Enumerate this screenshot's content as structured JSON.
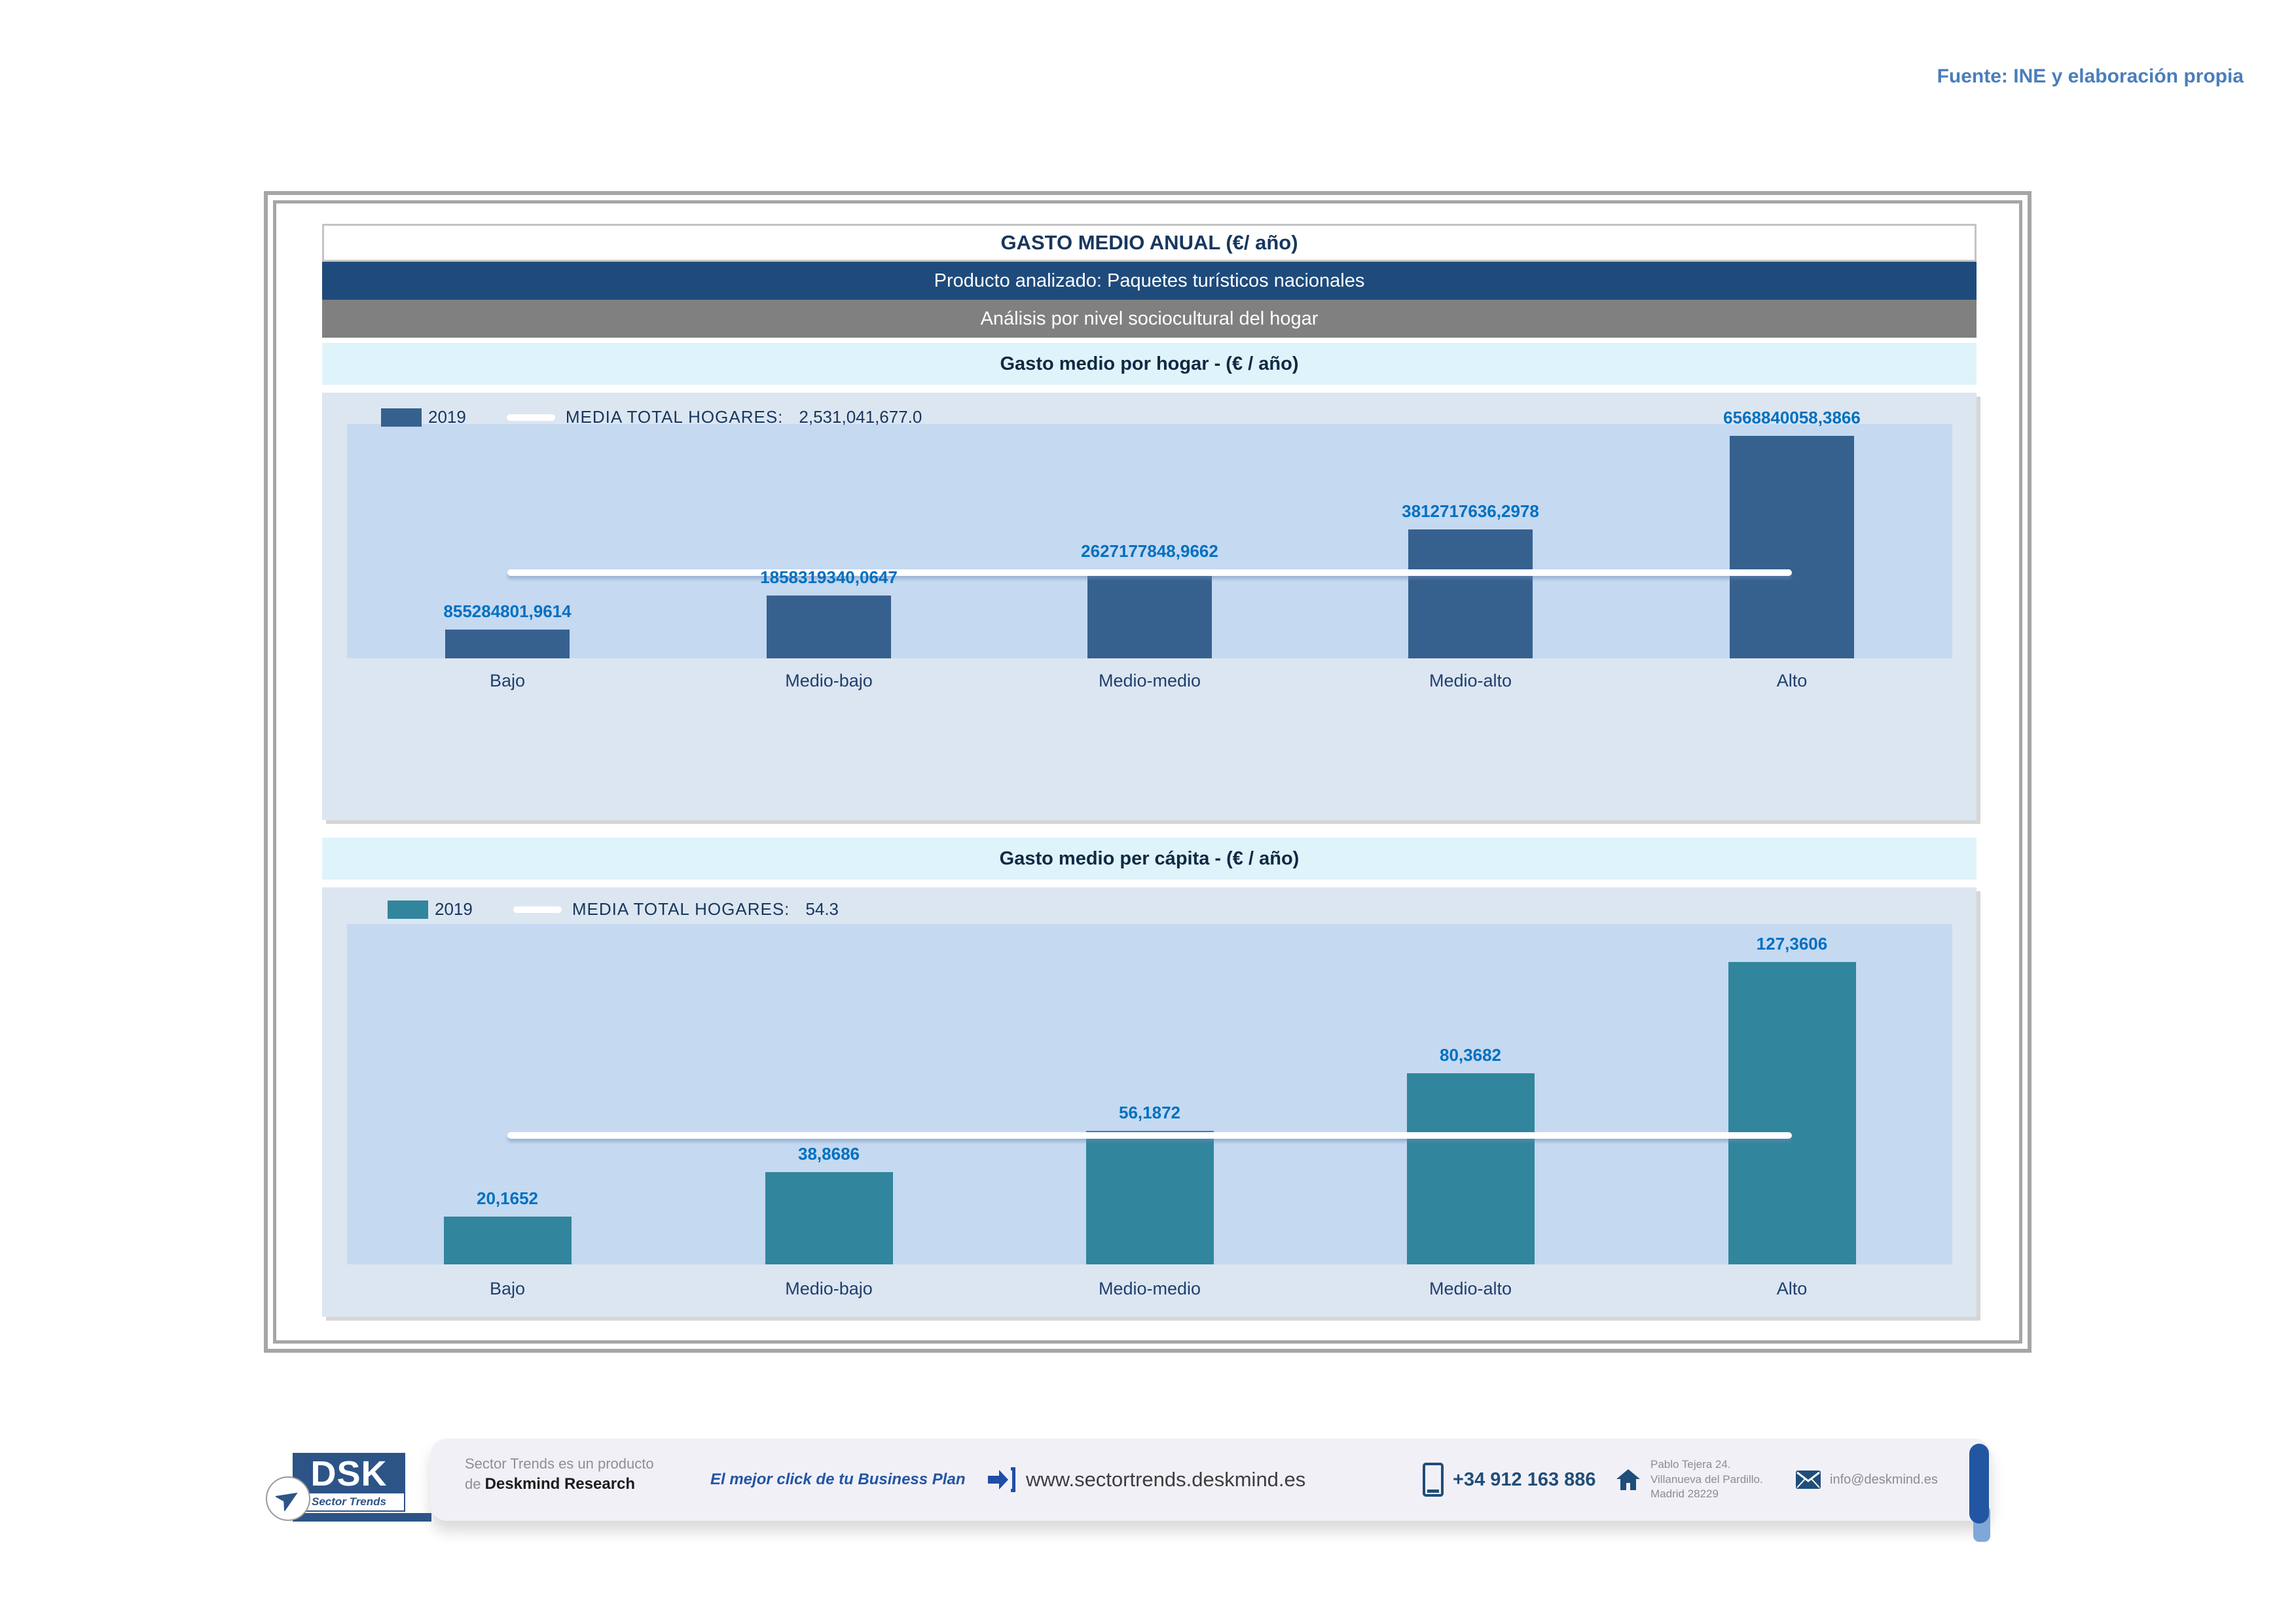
{
  "page": {
    "source_note": "Fuente: INE y elaboración propia"
  },
  "header": {
    "title": "GASTO MEDIO ANUAL (€/ año)",
    "product_bar": "Producto analizado: Paquetes turísticos nacionales",
    "analysis_bar": "Análisis por nivel sociocultural del hogar"
  },
  "chart_data": [
    {
      "type": "bar",
      "section_title": "Gasto medio por hogar -  (€ / año)",
      "legend": {
        "series_label": "2019",
        "mean_label": "MEDIA TOTAL  HOGARES:",
        "mean_value_text": "2,531,041,677.0"
      },
      "categories": [
        "Bajo",
        "Medio-bajo",
        "Medio-medio",
        "Medio-alto",
        "Alto"
      ],
      "values": [
        855284801.9614,
        1858319340.0647,
        2627177848.9662,
        3812717636.2978,
        6568840058.3866
      ],
      "value_labels": [
        "855284801,9614",
        "1858319340,0647",
        "2627177848,9662",
        "3812717636,2978",
        "6568840058,3866"
      ],
      "mean_value": 2531041677.0,
      "bar_color": "#36618E",
      "mean_line_color": "#FFFFFF",
      "plot_bg": "#C5D9F1",
      "panel_bg": "#DCE6F1",
      "value_label_color": "#0070C0",
      "legend_position": "top-left",
      "grid": false
    },
    {
      "type": "bar",
      "section_title": "Gasto medio per cápita -  (€ / año)",
      "legend": {
        "series_label": "2019",
        "mean_label": "MEDIA TOTAL  HOGARES:",
        "mean_value_text": "54.3"
      },
      "categories": [
        "Bajo",
        "Medio-bajo",
        "Medio-medio",
        "Medio-alto",
        "Alto"
      ],
      "values": [
        20.1652,
        38.8686,
        56.1872,
        80.3682,
        127.3606
      ],
      "value_labels": [
        "20,1652",
        "38,8686",
        "56,1872",
        "80,3682",
        "127,3606"
      ],
      "mean_value": 54.3,
      "bar_color": "#31859C",
      "mean_line_color": "#FFFFFF",
      "plot_bg": "#C5D9F1",
      "panel_bg": "#DCE6F1",
      "value_label_color": "#0070C0",
      "legend_position": "top-left",
      "grid": false
    }
  ],
  "footer": {
    "logo": {
      "acronym": "DSK",
      "sublabel": "Sector Trends",
      "icon": "paper-plane-icon"
    },
    "product_line_1": "Sector Trends es un producto",
    "product_line_2_prefix": "de ",
    "product_line_2_bold": "Deskmind Research",
    "tagline": "El mejor click de tu Business Plan",
    "website": "www.sectortrends.deskmind.es",
    "phone": "+34 912 163 886",
    "address_lines": [
      "Pablo Tejera 24.",
      "Villanueva del Pardillo.",
      "Madrid 28229"
    ],
    "email": "info@deskmind.es",
    "icons": {
      "website": "arrow-right-bracket-icon",
      "phone": "mobile-phone-icon",
      "address": "house-icon",
      "email": "envelope-icon"
    }
  },
  "colors": {
    "header_bar_blue": "#1F4B7C",
    "header_bar_gray": "#808080",
    "section_header_bg": "#DFF3FB",
    "source_note_blue": "#4A7EBB",
    "footer_navy": "#1F4E79",
    "footer_capsule_blue": "#2356A2",
    "logo_blue": "#2D5486"
  }
}
